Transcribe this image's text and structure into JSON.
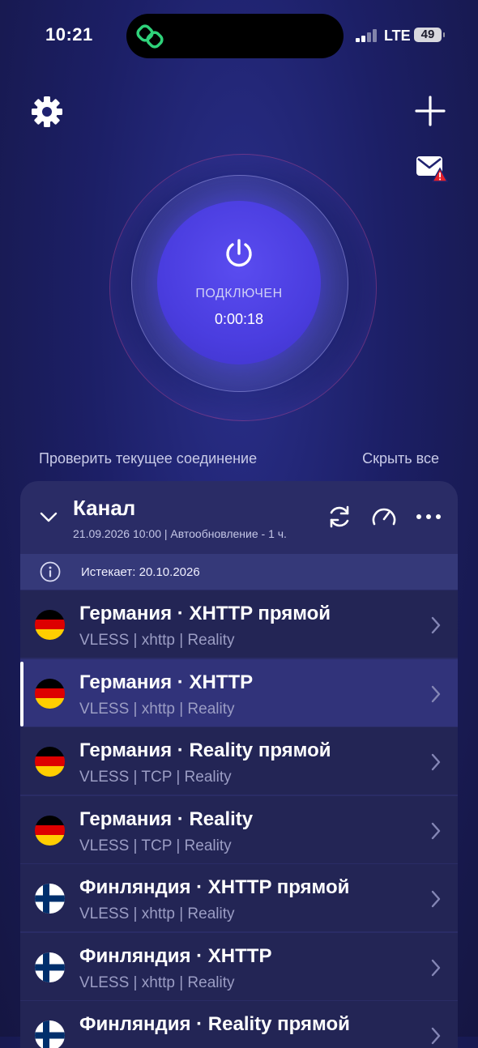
{
  "status_bar": {
    "time": "10:21",
    "network": "LTE",
    "battery": "49"
  },
  "connection": {
    "status": "ПОДКЛЮЧЕН",
    "timer": "0:00:18"
  },
  "links": {
    "check": "Проверить текущее соединение",
    "hide": "Скрыть все"
  },
  "channel": {
    "title": "Канал",
    "meta": "21.09.2026 10:00 | Автообновление - 1 ч.",
    "expires": "Истекает: 20.10.2026"
  },
  "servers": [
    {
      "name": "Германия · XHTTP прямой",
      "proto": "VLESS | xhttp | Reality",
      "flag": "germany-flag",
      "selected": false
    },
    {
      "name": "Германия · XHTTP",
      "proto": "VLESS | xhttp | Reality",
      "flag": "germany-flag",
      "selected": true
    },
    {
      "name": "Германия · Reality прямой",
      "proto": "VLESS | TCP | Reality",
      "flag": "germany-flag",
      "selected": false
    },
    {
      "name": "Германия · Reality",
      "proto": "VLESS | TCP | Reality",
      "flag": "germany-flag",
      "selected": false
    },
    {
      "name": "Финляндия · XHTTP прямой",
      "proto": "VLESS | xhttp | Reality",
      "flag": "finland-flag",
      "selected": false
    },
    {
      "name": "Финляндия · XHTTP",
      "proto": "VLESS | xhttp | Reality",
      "flag": "finland-flag",
      "selected": false
    },
    {
      "name": "Финляндия · Reality прямой",
      "proto": "",
      "flag": "finland-flag",
      "selected": false
    }
  ],
  "colors": {
    "accent": "#4a3ddf",
    "alert": "#e5202a",
    "app_glyph": "#2fd27a"
  }
}
